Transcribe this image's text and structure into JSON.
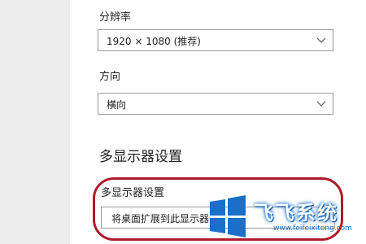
{
  "resolution": {
    "label": "分辨率",
    "value": "1920 × 1080 (推荐)"
  },
  "orientation": {
    "label": "方向",
    "value": "横向"
  },
  "multi_display": {
    "section_title": "多显示器设置",
    "label": "多显示器设置",
    "value": "将桌面扩展到此显示器"
  },
  "watermark": {
    "text": "飞飞系统",
    "url": "www.feifeixitong.com"
  },
  "colors": {
    "highlight": "#b01a2a",
    "watermark_blue": "#1b6fc7"
  },
  "icons": {
    "dropdown": "chevron-down-icon",
    "logo": "windows-logo-icon"
  }
}
